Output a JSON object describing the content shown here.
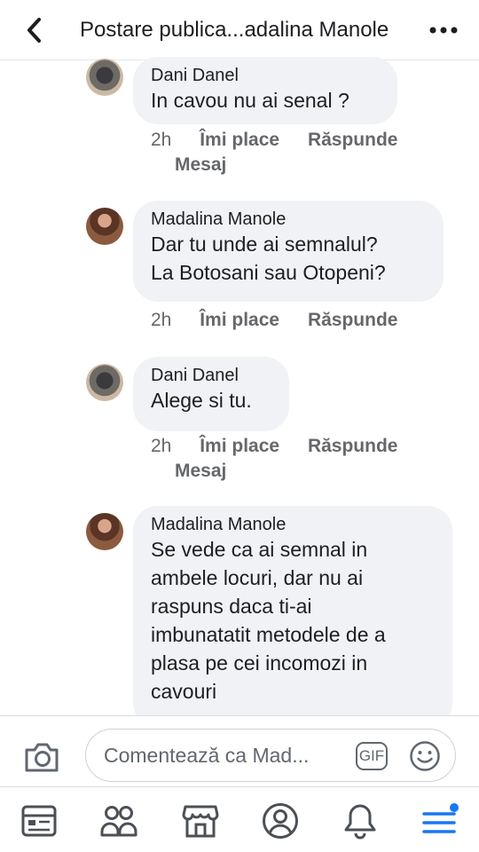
{
  "header": {
    "title": "Postare publica...adalina Manole"
  },
  "comments": [
    {
      "author": "Dani Danel",
      "lines": [
        "In cavou nu ai senal ?"
      ],
      "time": "2h",
      "like": "Îmi place",
      "reply": "Răspunde",
      "message": "Mesaj"
    },
    {
      "author": "Madalina Manole",
      "lines": [
        "Dar tu unde ai semnalul?",
        "La Botosani sau Otopeni?"
      ],
      "time": "2h",
      "like": "Îmi place",
      "reply": "Răspunde"
    },
    {
      "author": "Dani Danel",
      "lines": [
        "Alege si tu."
      ],
      "time": "2h",
      "like": "Îmi place",
      "reply": "Răspunde",
      "message": "Mesaj"
    },
    {
      "author": "Madalina Manole",
      "lines": [
        "Se vede ca ai semnal in",
        "ambele locuri, dar nu ai",
        "raspuns daca ti-ai",
        "imbunatatit metodele de a",
        "plasa pe cei incomozi in",
        "cavouri"
      ]
    }
  ],
  "composer": {
    "placeholder": "Comentează ca Mad...",
    "gif": "GIF"
  },
  "nav": {
    "icons": [
      "news-feed-icon",
      "groups-icon",
      "marketplace-icon",
      "profile-icon",
      "notifications-icon",
      "menu-icon"
    ],
    "menu_badge_color": "#1877f2"
  },
  "colors": {
    "bubble": "#f0f2f5",
    "meta": "#65676b",
    "icon": "#4b4f56"
  }
}
